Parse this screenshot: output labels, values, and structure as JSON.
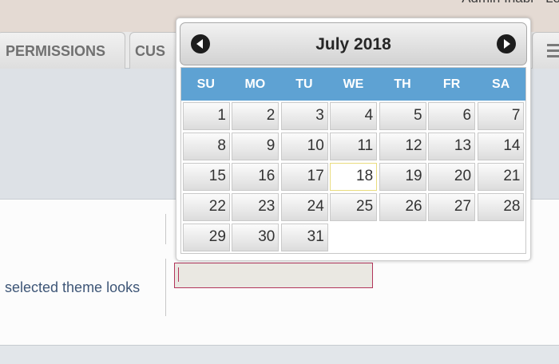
{
  "header": {
    "user_text": "Admin Inabl · Lo"
  },
  "tabs": [
    {
      "label": "PERMISSIONS"
    },
    {
      "label": "CUS"
    }
  ],
  "form": {
    "description": "selected theme looks",
    "date_value": ""
  },
  "datepicker": {
    "title": "July 2018",
    "weekdays": [
      "SU",
      "MO",
      "TU",
      "WE",
      "TH",
      "FR",
      "SA"
    ],
    "weeks": [
      [
        "1",
        "2",
        "3",
        "4",
        "5",
        "6",
        "7"
      ],
      [
        "8",
        "9",
        "10",
        "11",
        "12",
        "13",
        "14"
      ],
      [
        "15",
        "16",
        "17",
        "18",
        "19",
        "20",
        "21"
      ],
      [
        "22",
        "23",
        "24",
        "25",
        "26",
        "27",
        "28"
      ],
      [
        "29",
        "30",
        "31",
        "",
        "",
        "",
        ""
      ]
    ],
    "highlighted_day": "18",
    "colors": {
      "header_row": "#5ea2d3",
      "highlight_border": "#e9dc7e",
      "input_border": "#b2355b"
    }
  }
}
